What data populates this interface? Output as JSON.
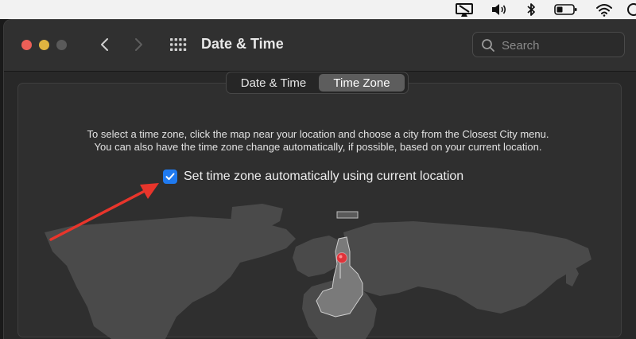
{
  "window": {
    "title": "Date & Time"
  },
  "search": {
    "placeholder": "Search"
  },
  "tabs": [
    {
      "label": "Date & Time",
      "selected": false
    },
    {
      "label": "Time Zone",
      "selected": true
    }
  ],
  "description": {
    "line1": "To select a time zone, click the map near your location and choose a city from the Closest City menu.",
    "line2": "You can also have the time zone change automatically, if possible, based on your current location."
  },
  "auto_timezone": {
    "label": "Set time zone automatically using current location",
    "checked": true
  },
  "colors": {
    "accent": "#1f7af0",
    "annotation_arrow": "#e8352b",
    "pin": "#e0333a"
  },
  "menubar_icons": [
    "display-icon",
    "volume-icon",
    "bluetooth-icon",
    "battery-icon",
    "wifi-icon",
    "control-center-icon"
  ]
}
